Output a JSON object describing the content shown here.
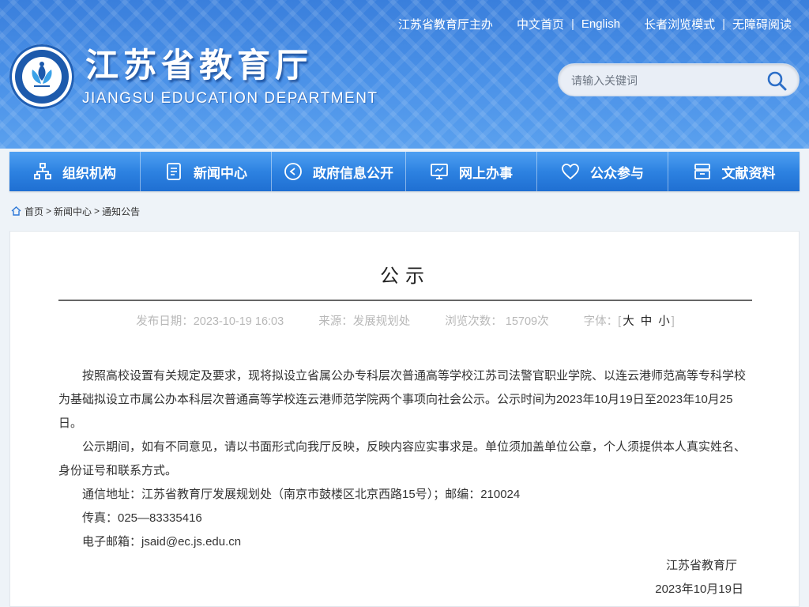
{
  "header": {
    "top_links": {
      "sponsor": "江苏省教育厅主办",
      "home_cn": "中文首页",
      "english": "English",
      "elderly_mode": "长者浏览模式",
      "accessible": "无障碍阅读",
      "separator": "|"
    },
    "title": "江苏省教育厅",
    "subtitle": "JIANGSU EDUCATION DEPARTMENT",
    "search": {
      "placeholder": "请输入关键词",
      "icon": "search-icon"
    }
  },
  "nav": {
    "items": [
      {
        "label": "组织机构",
        "icon": "org-chart-icon"
      },
      {
        "label": "新闻中心",
        "icon": "document-icon"
      },
      {
        "label": "政府信息公开",
        "icon": "speaker-icon"
      },
      {
        "label": "网上办事",
        "icon": "monitor-icon"
      },
      {
        "label": "公众参与",
        "icon": "heart-icon"
      },
      {
        "label": "文献资料",
        "icon": "archive-icon"
      }
    ]
  },
  "breadcrumb": {
    "items": [
      "首页",
      "新闻中心",
      "通知公告"
    ],
    "separator": ">"
  },
  "article": {
    "title": "公示",
    "meta": {
      "date": "发布日期：2023-10-19 16:03",
      "source": "来源：发展规划处",
      "views": "浏览次数： 15709次",
      "font_label": "字体：",
      "bracket_open": "[",
      "font_large": "大",
      "font_medium": "中",
      "font_small": "小",
      "bracket_close": "]"
    },
    "paragraphs": [
      "按照高校设置有关规定及要求，现将拟设立省属公办专科层次普通高等学校江苏司法警官职业学院、以连云港师范高等专科学校为基础拟设立市属公办本科层次普通高等学校连云港师范学院两个事项向社会公示。公示时间为2023年10月19日至2023年10月25日。",
      "公示期间，如有不同意见，请以书面形式向我厅反映，反映内容应实事求是。单位须加盖单位公章，个人须提供本人真实姓名、身份证号和联系方式。",
      "通信地址：江苏省教育厅发展规划处（南京市鼓楼区北京西路15号）；邮编：210024",
      "传真：025—83335416",
      "电子邮箱：jsaid@ec.js.edu.cn"
    ],
    "signature_org": "江苏省教育厅",
    "signature_date": "2023年10月19日"
  },
  "colors": {
    "header_blue": "#3d85e0",
    "nav_blue": "#2d82e1",
    "meta_gray": "#b8b8b8"
  }
}
